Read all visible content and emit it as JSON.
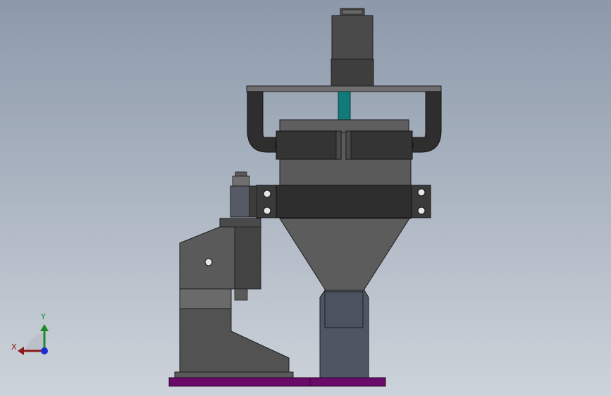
{
  "viewport": {
    "background_top": "#8d99ab",
    "background_bottom": "#cdd3da"
  },
  "triad": {
    "x_label": "X",
    "y_label": "Y",
    "x_color": "#8b1a1a",
    "y_color": "#1e8a2e",
    "z_color": "#1a2fd0"
  },
  "model": {
    "part_color_dark": "#3a3a3a",
    "part_color_mid": "#5f5f5f",
    "part_color_light": "#7a7a7a",
    "shaft_color": "#127a78",
    "base_plate_color": "#6a0b6a",
    "outlet_color": "#4e5563"
  }
}
